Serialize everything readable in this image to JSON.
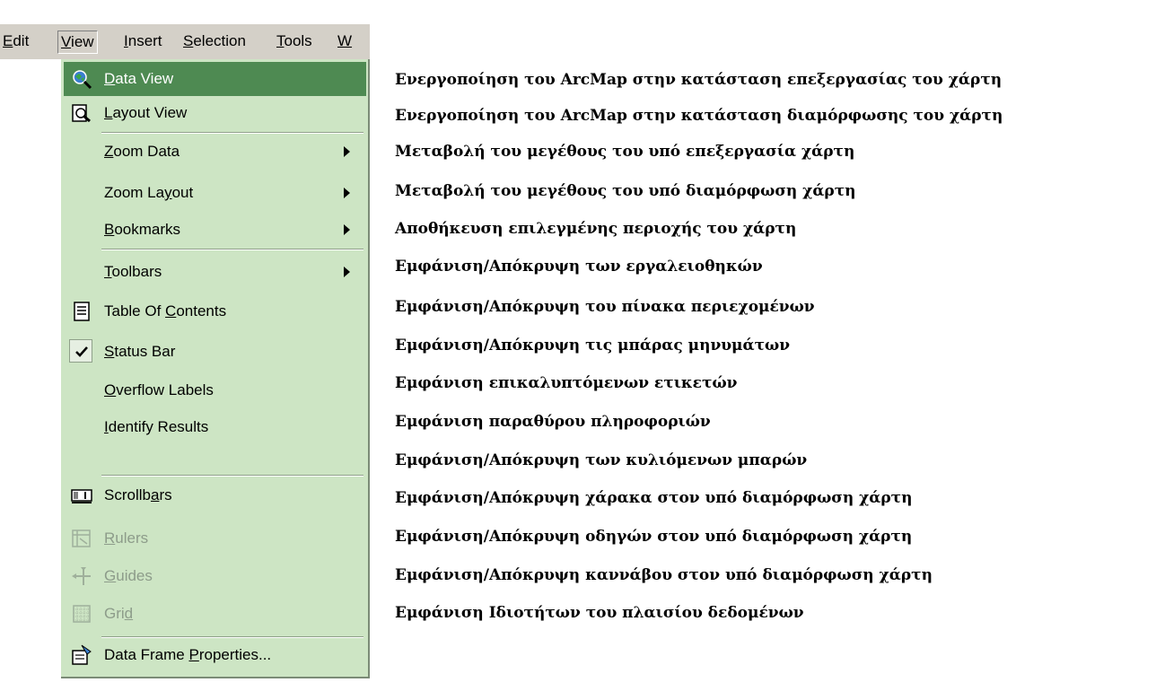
{
  "menubar": {
    "items": [
      {
        "pre": "",
        "u": "E",
        "post": "dit"
      },
      {
        "pre": "",
        "u": "V",
        "post": "iew"
      },
      {
        "pre": "",
        "u": "I",
        "post": "nsert"
      },
      {
        "pre": "",
        "u": "S",
        "post": "election"
      },
      {
        "pre": "",
        "u": "T",
        "post": "ools"
      },
      {
        "pre": "",
        "u": "W",
        "post": ""
      }
    ]
  },
  "menu": {
    "items": [
      {
        "pre": "",
        "u": "D",
        "post": "ata View",
        "icon": "data-view-icon",
        "state": "highlighted"
      },
      {
        "pre": "",
        "u": "L",
        "post": "ayout View",
        "icon": "layout-view-icon"
      },
      {
        "pre": "",
        "u": "Z",
        "post": "oom Data",
        "submenu": true
      },
      {
        "pre": "Zoom La",
        "u": "y",
        "post": "out",
        "submenu": true
      },
      {
        "pre": "",
        "u": "B",
        "post": "ookmarks",
        "submenu": true
      },
      {
        "pre": "",
        "u": "T",
        "post": "oolbars",
        "submenu": true
      },
      {
        "pre": "Table Of ",
        "u": "C",
        "post": "ontents",
        "icon": "table-of-contents-icon"
      },
      {
        "pre": "",
        "u": "S",
        "post": "tatus Bar",
        "icon": "checkmark-icon",
        "checked": true
      },
      {
        "pre": "",
        "u": "O",
        "post": "verflow Labels"
      },
      {
        "pre": "",
        "u": "I",
        "post": "dentify Results"
      },
      {
        "pre": "Scrollb",
        "u": "a",
        "post": "rs",
        "icon": "scrollbars-icon"
      },
      {
        "pre": "",
        "u": "R",
        "post": "ulers",
        "icon": "rulers-icon",
        "state": "disabled"
      },
      {
        "pre": "",
        "u": "G",
        "post": "uides",
        "icon": "guides-icon",
        "state": "disabled"
      },
      {
        "pre": "Gri",
        "u": "d",
        "post": "",
        "icon": "grid-icon",
        "state": "disabled"
      },
      {
        "pre": "Data Frame ",
        "u": "P",
        "post": "roperties...",
        "icon": "data-frame-properties-icon"
      }
    ]
  },
  "descriptions": [
    "Ενεργοποίηση του ArcMap στην κατάσταση επεξεργασίας του χάρτη",
    "Ενεργοποίηση του ArcMap στην κατάσταση διαμόρφωσης του χάρτη",
    "Μεταβολή του μεγέθους του υπό επεξεργασία χάρτη",
    "Μεταβολή του μεγέθους του υπό διαμόρφωση χάρτη",
    "Αποθήκευση επιλεγμένης περιοχής του χάρτη",
    "Εμφάνιση/Απόκρυψη των εργαλειοθηκών",
    "Εμφάνιση/Απόκρυψη του πίνακα περιεχομένων",
    "Εμφάνιση/Απόκρυψη τις μπάρας μηνυμάτων",
    "Εμφάνιση επικαλυπτόμενων ετικετών",
    "Εμφάνιση παραθύρου πληροφοριών",
    "Εμφάνιση/Απόκρυψη των κυλιόμενων μπαρών",
    "Εμφάνιση/Απόκρυψη χάρακα στον υπό διαμόρφωση χάρτη",
    "Εμφάνιση/Απόκρυψη οδηγών στον υπό διαμόρφωση χάρτη",
    "Εμφάνιση/Απόκρυψη καννάβου στον υπό διαμόρφωση χάρτη",
    "Εμφάνιση Ιδιοτήτων του πλαισίου δεδομένων"
  ],
  "colors": {
    "menu_bg": "#cde5c4",
    "highlight": "#4e8a52",
    "menubar_bg": "#d4d0c8",
    "disabled_text": "#8d9c8a"
  }
}
